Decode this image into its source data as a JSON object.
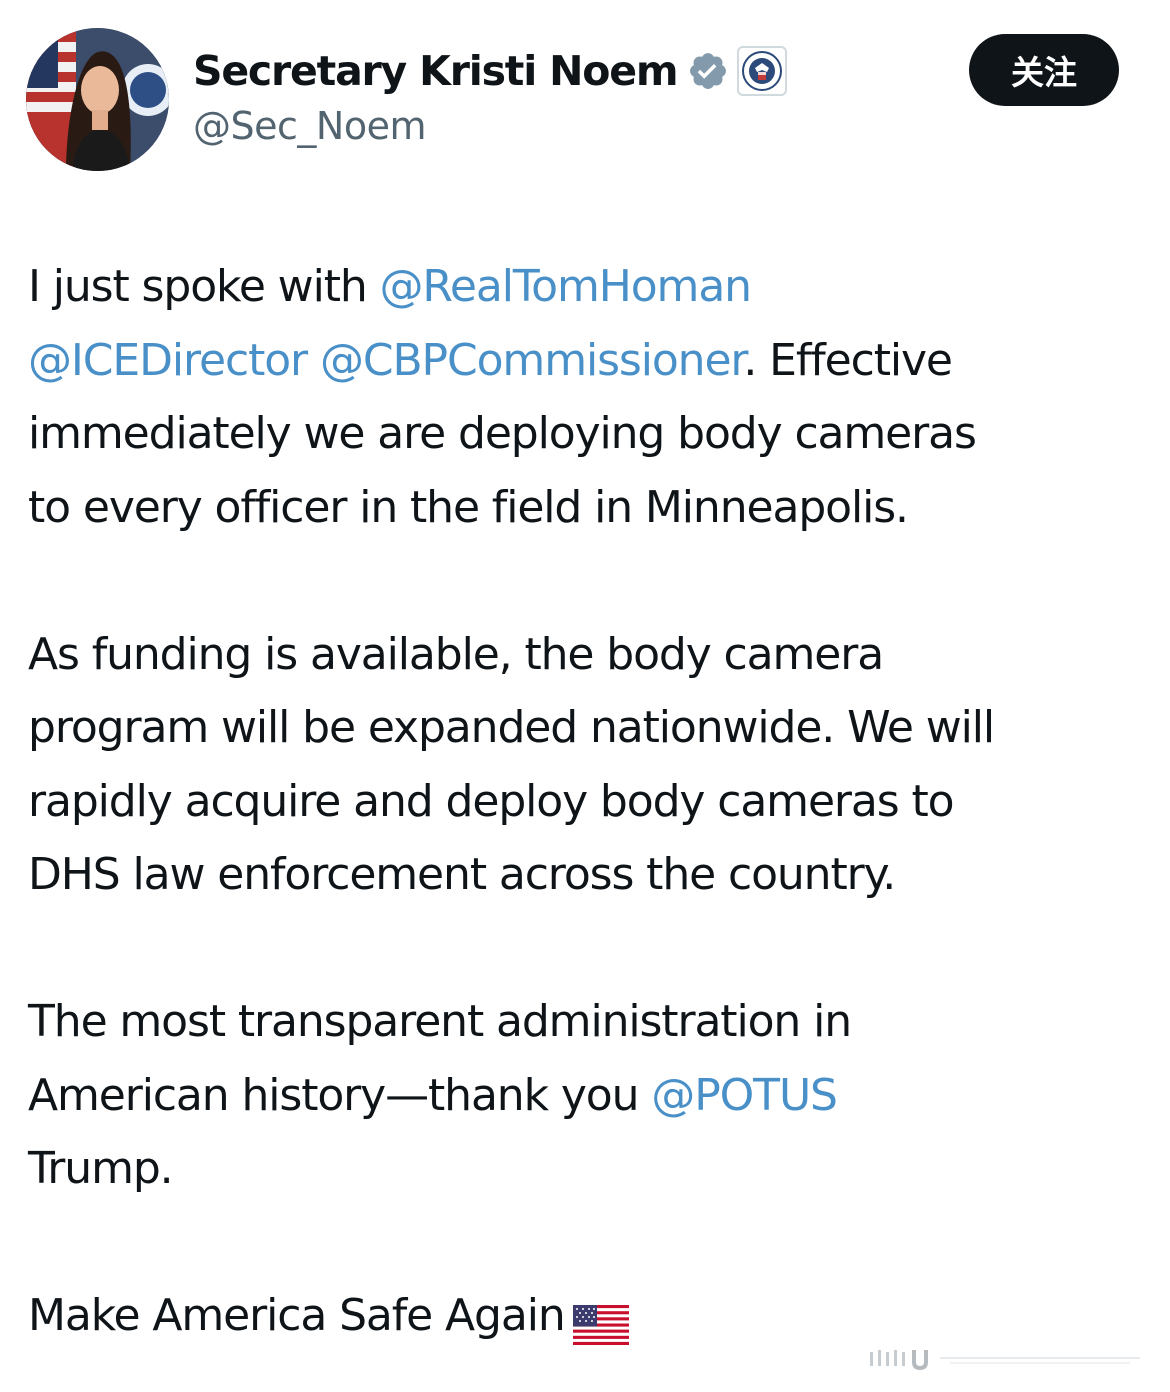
{
  "profile": {
    "display_name": "Secretary Kristi Noem",
    "handle": "@Sec_Noem",
    "verified_icon": "verified-badge-icon",
    "affiliation_icon": "dhs-seal-icon",
    "avatar": "profile-avatar"
  },
  "follow_button": {
    "label": "关注"
  },
  "tweet": {
    "p1": {
      "l1_text": "I just spoke with ",
      "l1_mention": "@RealTomHoman",
      "l2_mention1": "@ICEDirector",
      "l2_space": " ",
      "l2_mention2": "@CBPCommissioner",
      "l2_text": ". Effective",
      "l3": "immediately we are deploying body cameras",
      "l4": "to every officer in the field in Minneapolis."
    },
    "p2": {
      "l1": "As funding is available, the body camera",
      "l2": "program will be expanded nationwide. We will",
      "l3": "rapidly acquire and deploy body cameras to",
      "l4": "DHS law enforcement across the country."
    },
    "p3": {
      "l1": "The most transparent administration in",
      "l2_text": "American history—thank you ",
      "l2_mention": "@POTUS",
      "l3": "Trump."
    },
    "p4": {
      "l1": "Make America Safe Again",
      "emoji": "us-flag-icon"
    }
  },
  "colors": {
    "mention": "#4a90c8",
    "text": "#0f1419",
    "secondary": "#536471",
    "button_bg": "#0f1419",
    "button_text": "#ffffff",
    "verified": "#829aab"
  }
}
